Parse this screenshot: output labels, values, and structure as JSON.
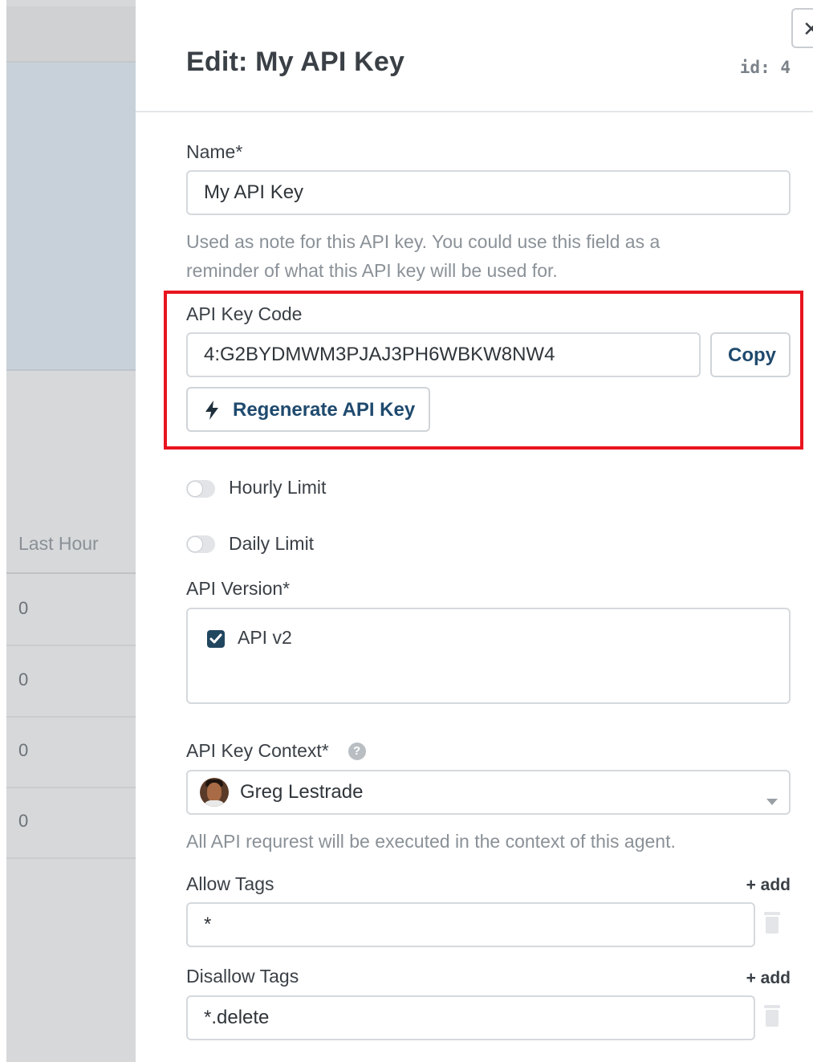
{
  "background": {
    "column_header": "Last Hour",
    "rows": [
      "0",
      "0",
      "0",
      "0"
    ]
  },
  "drawer": {
    "title": "Edit: My API Key",
    "id_label": "id: 4",
    "close_icon": "close-icon"
  },
  "form": {
    "name": {
      "label": "Name*",
      "value": "My API Key",
      "help_line1": "Used as note for this API key. You could use this field as a",
      "help_line2": "reminder of what this API key will be used for."
    },
    "api_key_code": {
      "label": "API Key Code",
      "value": "4:G2BYDMWM3PJAJ3PH6WBKW8NW4",
      "copy_label": "Copy",
      "regenerate_label": "Regenerate API Key",
      "regenerate_icon": "bolt-icon"
    },
    "hourly_limit": {
      "label": "Hourly Limit",
      "enabled": false
    },
    "daily_limit": {
      "label": "Daily Limit",
      "enabled": false
    },
    "api_version": {
      "label": "API Version*",
      "options": [
        {
          "label": "API v2",
          "checked": true
        }
      ]
    },
    "api_key_context": {
      "label": "API Key Context*",
      "selected": "Greg Lestrade",
      "help": "All API requrest will be executed in the context of this agent."
    },
    "allow_tags": {
      "label": "Allow Tags",
      "add_label": "+ add",
      "value": "*"
    },
    "disallow_tags": {
      "label": "Disallow Tags",
      "add_label": "+ add",
      "value": "*.delete"
    }
  },
  "colors": {
    "highlight": "#e8141e",
    "accent": "#1f4a6e",
    "checkbox": "#21465f"
  }
}
